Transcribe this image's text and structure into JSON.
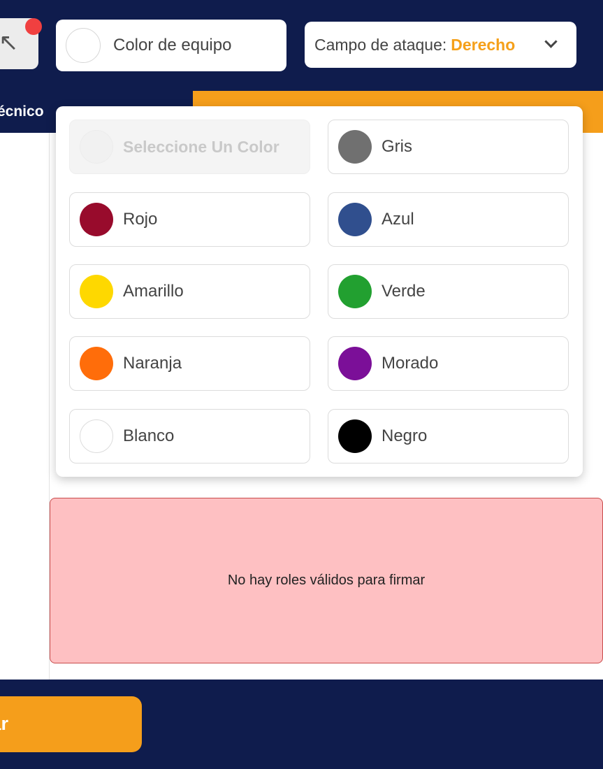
{
  "header": {
    "back_icon": "arrow-up-left-icon",
    "team_color_label": "Color de equipo",
    "team_color_value": "#ffffff",
    "attack_field_label": "Campo de ataque:",
    "attack_field_value": "Derecho"
  },
  "tabs": {
    "left_label": "écnico"
  },
  "color_dropdown": {
    "placeholder": "Seleccione Un Color",
    "options": [
      {
        "name": "Gris",
        "color": "#707070"
      },
      {
        "name": "Rojo",
        "color": "#980b2c"
      },
      {
        "name": "Azul",
        "color": "#304f8e"
      },
      {
        "name": "Amarillo",
        "color": "#fed800"
      },
      {
        "name": "Verde",
        "color": "#22a030"
      },
      {
        "name": "Naranja",
        "color": "#ff6d0a"
      },
      {
        "name": "Morado",
        "color": "#7b0f98"
      },
      {
        "name": "Blanco",
        "color": "#ffffff"
      },
      {
        "name": "Negro",
        "color": "#000000"
      }
    ]
  },
  "error": {
    "message": "No hay roles válidos para firmar"
  },
  "footer": {
    "continue_label": "uar"
  },
  "colors": {
    "navy": "#0f1c4d",
    "accent": "#f59e1b",
    "error_bg": "#fec0c2"
  }
}
